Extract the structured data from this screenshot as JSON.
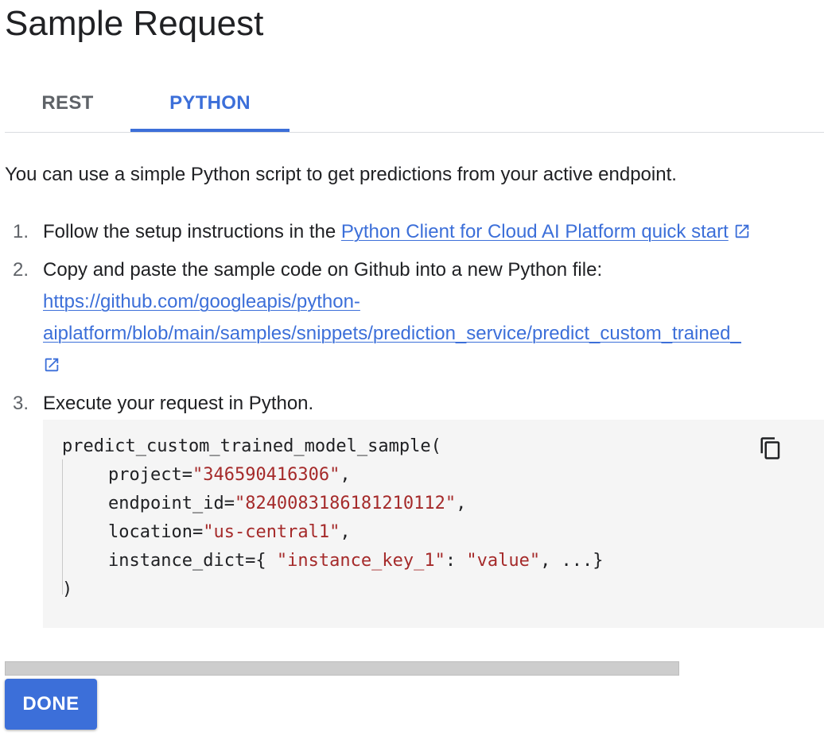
{
  "dialog": {
    "title": "Sample Request"
  },
  "tabs": [
    {
      "label": "REST",
      "selected": false
    },
    {
      "label": "PYTHON",
      "selected": true
    }
  ],
  "intro": "You can use a simple Python script to get predictions from your active endpoint.",
  "steps": [
    {
      "number": "1.",
      "text": "Follow the setup instructions in the ",
      "link": "Python Client for Cloud AI Platform quick start",
      "link_icon": "external-link-icon"
    },
    {
      "number": "2.",
      "text": "Copy and paste the sample code on Github into a new Python file:",
      "link_line1": "https://github.com/googleapis/python-",
      "link_line2": "aiplatform/blob/main/samples/snippets/prediction_service/predict_custom_trained_",
      "link_icon": "external-link-icon"
    },
    {
      "number": "3.",
      "text": "Execute your request in Python."
    }
  ],
  "code": {
    "function": "predict_custom_trained_model_sample(",
    "project_key": "project=",
    "project_value": "\"346590416306\"",
    "endpoint_key": "endpoint_id=",
    "endpoint_value": "\"8240083186181210112\"",
    "location_key": "location=",
    "location_value": "\"us-central1\"",
    "instance_key": "instance_dict={ ",
    "instance_key_str": "\"instance_key_1\"",
    "instance_colon": ": ",
    "instance_value_str": "\"value\"",
    "instance_rest": ", ...}",
    "closing": ")",
    "comma": ",",
    "copy_icon": "copy-icon"
  },
  "footer": {
    "done_label": "DONE"
  },
  "colors": {
    "accent": "#3c6fd9",
    "string": "#a52a2a",
    "code_background": "#f5f5f5"
  }
}
